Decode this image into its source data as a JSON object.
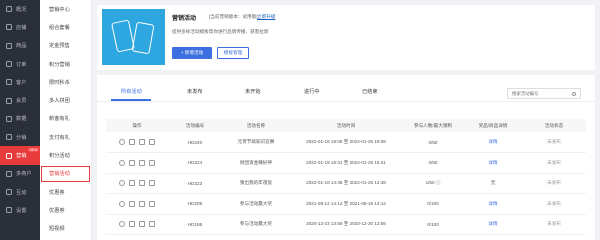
{
  "sidebar_primary": [
    {
      "label": "概况"
    },
    {
      "label": "店铺"
    },
    {
      "label": "商品"
    },
    {
      "label": "订单"
    },
    {
      "label": "客户"
    },
    {
      "label": "会员"
    },
    {
      "label": "数据"
    },
    {
      "label": "分销"
    },
    {
      "label": "营销",
      "badge": "NEW"
    },
    {
      "label": "多商户"
    },
    {
      "label": "互动"
    },
    {
      "label": "设置"
    }
  ],
  "sidebar_secondary": [
    {
      "label": "营销中心"
    },
    {
      "label": "组合套餐"
    },
    {
      "label": "定金预售"
    },
    {
      "label": "积分营销"
    },
    {
      "label": "限时秒杀"
    },
    {
      "label": "多人拼团"
    },
    {
      "label": "新客有礼"
    },
    {
      "label": "支付有礼"
    },
    {
      "label": "积分活动"
    },
    {
      "label": "营销活动"
    },
    {
      "label": "优惠券"
    },
    {
      "label": "优惠券"
    },
    {
      "label": "短视频"
    }
  ],
  "header": {
    "title": "营销活动",
    "version": "[当前营销版本：试用版]",
    "upgrade": "立即升级",
    "description": "提供多样活动模板帮你进行品牌传播、获客拉新",
    "new_button": "+ 新增活动",
    "manage_button": "模板管理"
  },
  "tabs": [
    "所有活动",
    "未发布",
    "未开始",
    "进行中",
    "已结束"
  ],
  "search": {
    "placeholder": "搜索活动编号"
  },
  "table": {
    "headers": [
      "操作",
      "活动编号",
      "活动名称",
      "活动时间",
      "参与人数/最大限制",
      "奖品/商品详情",
      "活动状态"
    ],
    "rows": [
      {
        "id": "HD240",
        "name": "元宵节搞知识竞赛",
        "time": "2022-01-18 19:08 至 2022-01-25 19:08",
        "count": "0/50",
        "detail": "详情",
        "status": "未发布"
      },
      {
        "id": "HD224",
        "name": "财团资金赚好神",
        "time": "2022-01-18 15:31 至 2022-01-25 15:31",
        "count": "0/50",
        "detail": "详情",
        "status": "未发布"
      },
      {
        "id": "HD223",
        "name": "猜出我的年夜饭",
        "time": "2022-01-18 14:48 至 2022-01-25 14:48",
        "count": "1/50 ⓘ",
        "detail": "无",
        "status": "未发布"
      },
      {
        "id": "HD208",
        "name": "参与活动赢大奖",
        "time": "2021-08-12 14:12 至 2021-08-19 14:12",
        "count": "0/100",
        "detail": "详情",
        "status": "未发布"
      },
      {
        "id": "HD186",
        "name": "参与活动赢大奖",
        "time": "2020-12-23 13:56 至 2020-12-30 13:56",
        "count": "0/100",
        "detail": "详情",
        "status": "未发布"
      }
    ]
  },
  "colors": {
    "accent": "#e83b3b",
    "primary": "#3d6fe0",
    "sidebar": "#2b2f3a",
    "hero": "#2ea7e0"
  },
  "selected_secondary": "营销活动"
}
